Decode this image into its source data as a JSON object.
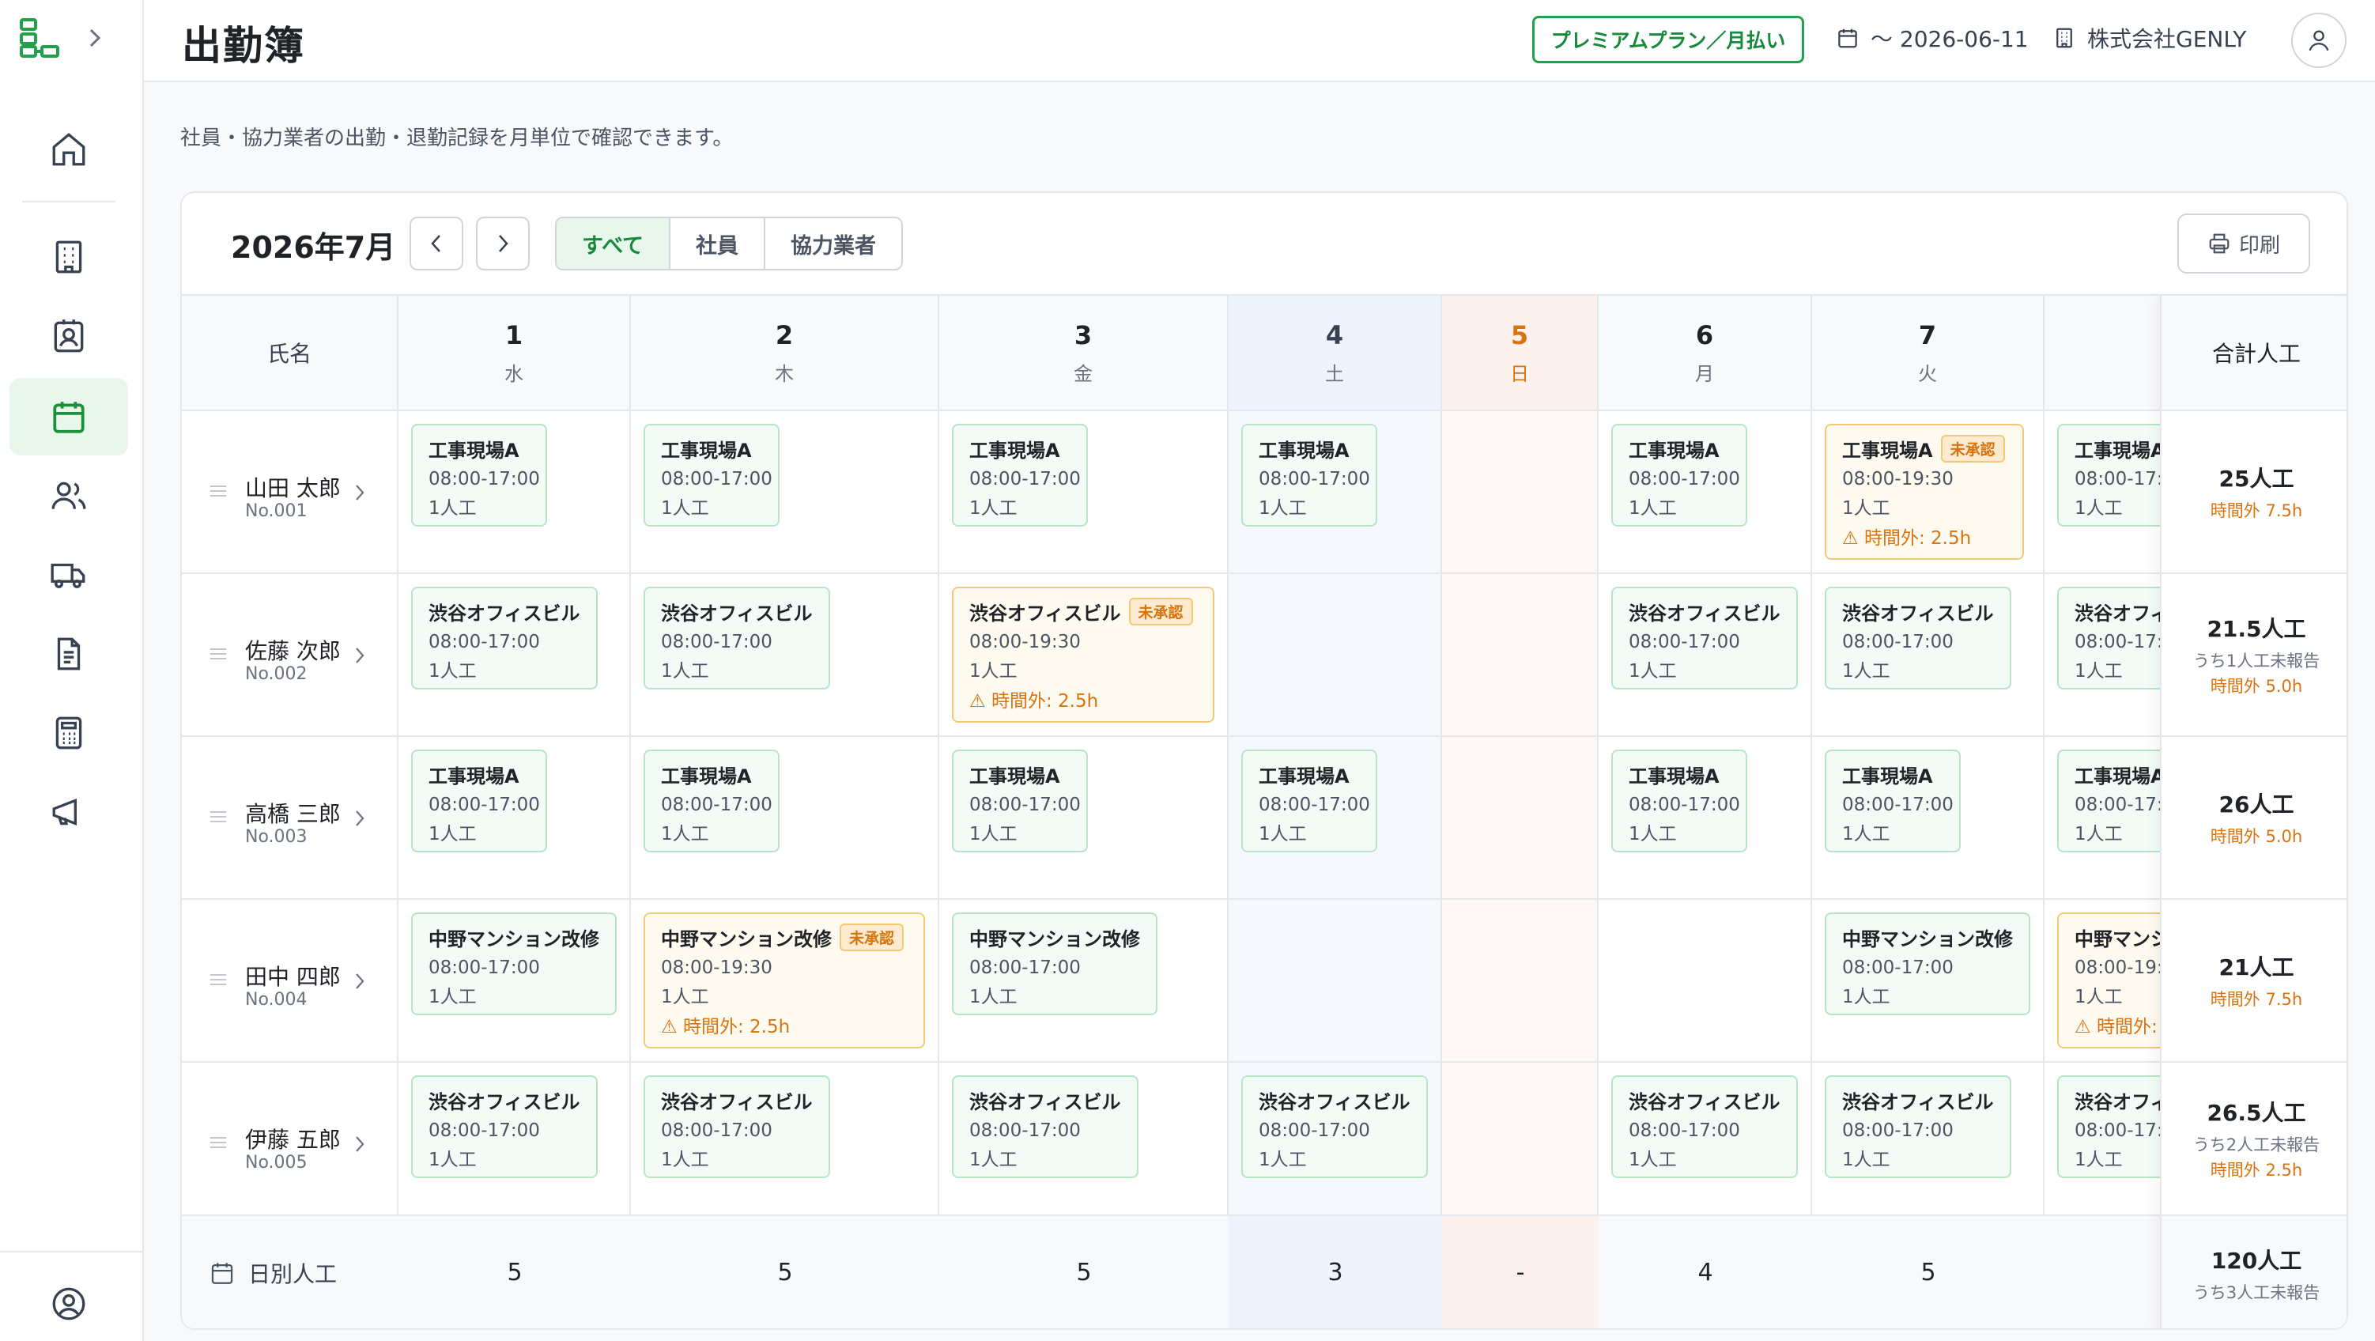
{
  "app": {
    "title": "出勤簿",
    "plan_badge": "プレミアムプラン／月払い",
    "date_range": "〜 2026-06-11",
    "company": "株式会社GENLY"
  },
  "description": "社員・協力業者の出勤・退勤記録を月単位で確認できます。",
  "toolbar": {
    "month": "2026年7月",
    "filters": [
      "すべて",
      "社員",
      "協力業者"
    ],
    "active_filter": "すべて",
    "print_label": "印刷"
  },
  "table": {
    "name_header": "氏名",
    "total_header": "合計人工",
    "days": [
      {
        "num": "1",
        "dow": "水"
      },
      {
        "num": "2",
        "dow": "木"
      },
      {
        "num": "3",
        "dow": "金"
      },
      {
        "num": "4",
        "dow": "土"
      },
      {
        "num": "5",
        "dow": "日"
      },
      {
        "num": "6",
        "dow": "月"
      },
      {
        "num": "7",
        "dow": "火"
      }
    ],
    "employees": [
      {
        "name": "山田 太郎",
        "no": "No.001",
        "total": "25人工",
        "note": "",
        "overtime": "時間外 7.5h"
      },
      {
        "name": "佐藤 次郎",
        "no": "No.002",
        "total": "21.5人工",
        "note": "うち1人工未報告",
        "overtime": "時間外 5.0h"
      },
      {
        "name": "高橋 三郎",
        "no": "No.003",
        "total": "26人工",
        "note": "",
        "overtime": "時間外 5.0h"
      },
      {
        "name": "田中 四郎",
        "no": "No.004",
        "total": "21人工",
        "note": "",
        "overtime": "時間外 7.5h"
      },
      {
        "name": "伊藤 五郎",
        "no": "No.005",
        "total": "26.5人工",
        "note": "うち2人工未報告",
        "overtime": "時間外 2.5h"
      }
    ],
    "shift_values": {
      "site_a": "工事現場A",
      "site_shibuya": "渋谷オフィスビル",
      "site_nakano": "中野マンション改修",
      "time_normal": "08:00-17:00",
      "time_long": "08:00-19:30",
      "count": "1人工",
      "overtime": "時間外: 2.5h",
      "pending": "未承認"
    },
    "daily_label": "日別人工",
    "daily_values": [
      "5",
      "5",
      "5",
      "3",
      "-",
      "4",
      "5"
    ],
    "grand_total": "120人工",
    "grand_note": "うち3人工未報告"
  }
}
